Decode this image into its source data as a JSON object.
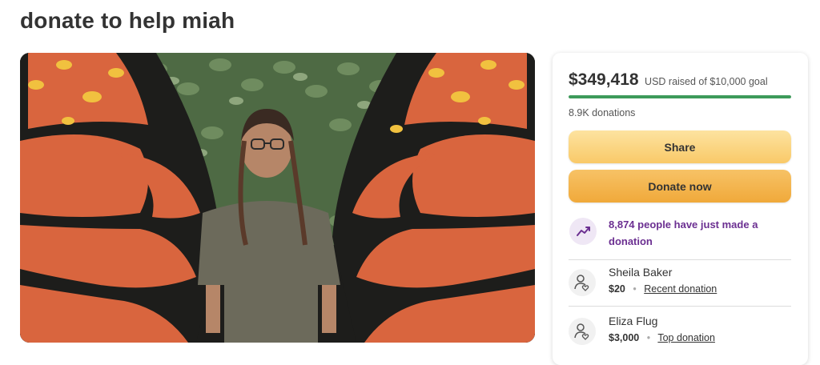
{
  "page": {
    "title": "donate to help miah"
  },
  "hero": {
    "alt": "girl standing in front of butterfly wings mural"
  },
  "fundraiser": {
    "amount": "$349,418",
    "goal_text": "USD raised of $10,000 goal",
    "progress_fraction": 1.0,
    "donations_count": "8.9K donations",
    "progress_color": "#3d9a5a"
  },
  "actions": {
    "share_label": "Share",
    "donate_label": "Donate now"
  },
  "activity": {
    "text": "8,874 people have just made a donation"
  },
  "donations": [
    {
      "name": "Sheila Baker",
      "amount": "$20",
      "tag": "Recent donation"
    },
    {
      "name": "Eliza Flug",
      "amount": "$3,000",
      "tag": "Top donation"
    }
  ],
  "icons": {
    "trend": "trending-up-icon",
    "donor": "donor-heart-icon"
  }
}
